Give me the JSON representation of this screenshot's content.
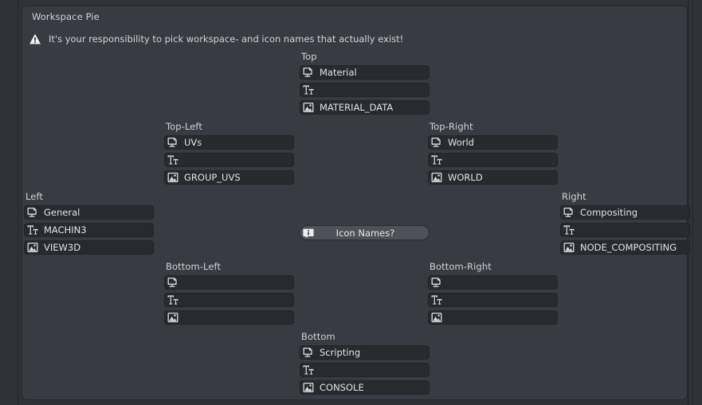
{
  "panel": {
    "title": "Workspace Pie",
    "warning": {
      "icon": "warning-triangle-icon",
      "text": "It's your responsibility to pick workspace- and icon names that actually exist!"
    }
  },
  "center_button": {
    "icon": "info-icon",
    "label": "Icon Names?"
  },
  "field_icons": {
    "workspace": "workspace-screen-icon",
    "text": "font-text-icon",
    "image": "image-data-icon"
  },
  "colors": {
    "panel_background": "#383b42",
    "window_background": "#2f3236",
    "field_background": "#282a2e",
    "field_border": "#22242a",
    "button_background": "#4e5157",
    "text": "#d2d3d5"
  },
  "groups": [
    {
      "id": "top",
      "label": "Top",
      "fields": [
        {
          "icon": "workspace",
          "value": "Material"
        },
        {
          "icon": "text",
          "value": ""
        },
        {
          "icon": "image",
          "value": "MATERIAL_DATA"
        }
      ]
    },
    {
      "id": "top-left",
      "label": "Top-Left",
      "fields": [
        {
          "icon": "workspace",
          "value": "UVs"
        },
        {
          "icon": "text",
          "value": ""
        },
        {
          "icon": "image",
          "value": "GROUP_UVS"
        }
      ]
    },
    {
      "id": "top-right",
      "label": "Top-Right",
      "fields": [
        {
          "icon": "workspace",
          "value": "World"
        },
        {
          "icon": "text",
          "value": ""
        },
        {
          "icon": "image",
          "value": "WORLD"
        }
      ]
    },
    {
      "id": "left",
      "label": "Left",
      "fields": [
        {
          "icon": "workspace",
          "value": "General"
        },
        {
          "icon": "text",
          "value": "MACHIN3"
        },
        {
          "icon": "image",
          "value": "VIEW3D"
        }
      ]
    },
    {
      "id": "right",
      "label": "Right",
      "fields": [
        {
          "icon": "workspace",
          "value": "Compositing"
        },
        {
          "icon": "text",
          "value": ""
        },
        {
          "icon": "image",
          "value": "NODE_COMPOSITING"
        }
      ]
    },
    {
      "id": "bottom-left",
      "label": "Bottom-Left",
      "fields": [
        {
          "icon": "workspace",
          "value": ""
        },
        {
          "icon": "text",
          "value": ""
        },
        {
          "icon": "image",
          "value": ""
        }
      ]
    },
    {
      "id": "bottom-right",
      "label": "Bottom-Right",
      "fields": [
        {
          "icon": "workspace",
          "value": ""
        },
        {
          "icon": "text",
          "value": ""
        },
        {
          "icon": "image",
          "value": ""
        }
      ]
    },
    {
      "id": "bottom",
      "label": "Bottom",
      "fields": [
        {
          "icon": "workspace",
          "value": "Scripting"
        },
        {
          "icon": "text",
          "value": ""
        },
        {
          "icon": "image",
          "value": "CONSOLE"
        }
      ]
    }
  ]
}
